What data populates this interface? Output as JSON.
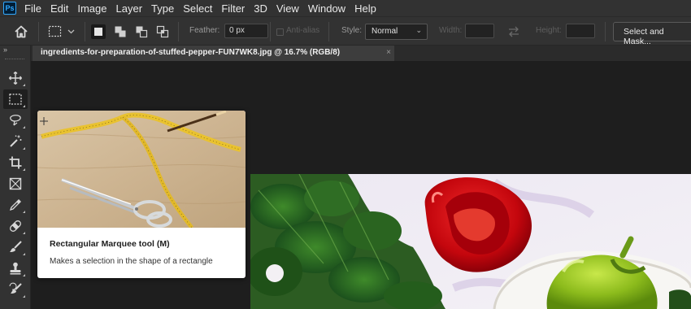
{
  "app": {
    "logo_text": "Ps"
  },
  "menu": [
    "File",
    "Edit",
    "Image",
    "Layer",
    "Type",
    "Select",
    "Filter",
    "3D",
    "View",
    "Window",
    "Help"
  ],
  "options": {
    "feather_label": "Feather:",
    "feather_value": "0 px",
    "antialias_label": "Anti-alias",
    "style_label": "Style:",
    "style_value": "Normal",
    "width_label": "Width:",
    "height_label": "Height:",
    "select_and_mask": "Select and Mask..."
  },
  "document": {
    "tab_title": "ingredients-for-preparation-of-stuffed-pepper-FUN7WK8.jpg @ 16.7% (RGB/8)",
    "close_glyph": "×"
  },
  "toolbar": {
    "collapse_glyph": "»",
    "tools": [
      {
        "name": "move-tool",
        "icon": "move-icon"
      },
      {
        "name": "rectangular-marquee-tool",
        "icon": "marquee-icon",
        "active": true
      },
      {
        "name": "lasso-tool",
        "icon": "lasso-icon"
      },
      {
        "name": "magic-wand-tool",
        "icon": "magic-wand-icon"
      },
      {
        "name": "crop-tool",
        "icon": "crop-icon"
      },
      {
        "name": "frame-tool",
        "icon": "frame-icon"
      },
      {
        "name": "eyedropper-tool",
        "icon": "eyedropper-icon"
      },
      {
        "name": "healing-brush-tool",
        "icon": "bandage-icon"
      },
      {
        "name": "brush-tool",
        "icon": "brush-icon"
      },
      {
        "name": "clone-stamp-tool",
        "icon": "stamp-icon"
      },
      {
        "name": "history-brush-tool",
        "icon": "history-brush-icon"
      }
    ]
  },
  "tooltip": {
    "title": "Rectangular Marquee tool (M)",
    "description": "Makes a selection in the shape of a rectangle"
  },
  "colors": {
    "panel": "#323232",
    "workspace": "#1e1e1e",
    "accent": "#31a8ff",
    "tab_active": "#3d3d3d"
  }
}
